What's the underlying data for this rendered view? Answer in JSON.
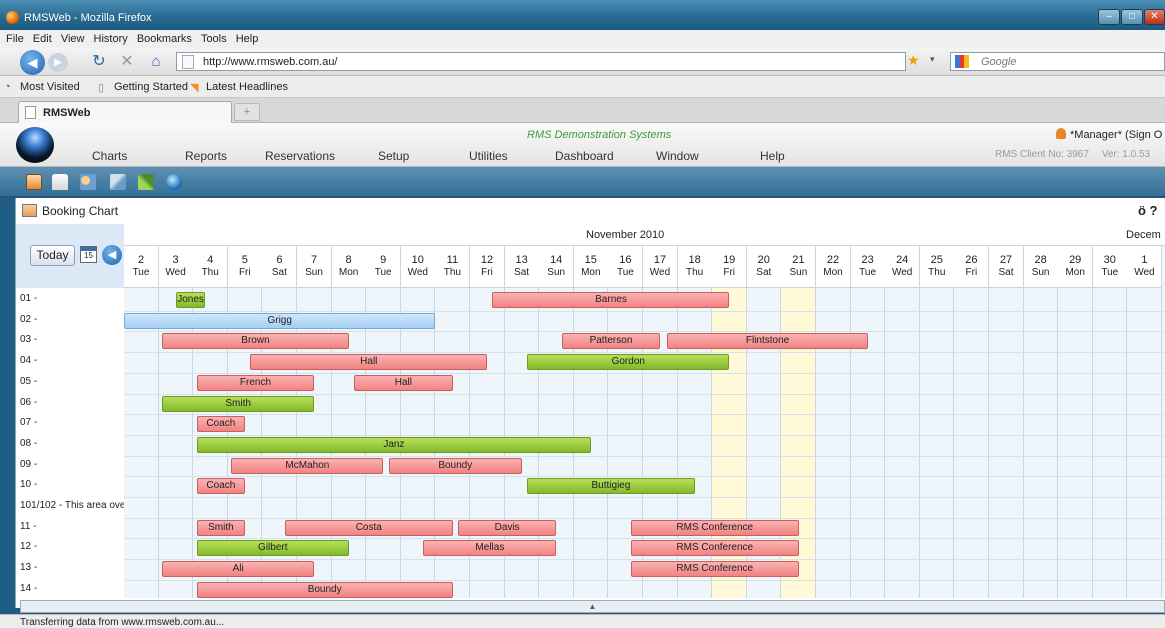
{
  "window": {
    "title": "RMSWeb - Mozilla Firefox"
  },
  "menubar": [
    "File",
    "Edit",
    "View",
    "History",
    "Bookmarks",
    "Tools",
    "Help"
  ],
  "address": {
    "url": "http://www.rmsweb.com.au/",
    "search_placeholder": "Google"
  },
  "bookmarks": [
    "Most Visited",
    "Getting Started",
    "Latest Headlines"
  ],
  "tab": {
    "label": "RMSWeb",
    "new_tab": "+"
  },
  "app": {
    "company": "RMS Demonstration Systems",
    "menu": [
      "Charts",
      "Reports",
      "Reservations",
      "Setup",
      "Utilities",
      "Dashboard",
      "Window",
      "Help"
    ],
    "user": "*Manager* (Sign O",
    "client": "RMS Client No: 3967",
    "version": "Ver: 1.0.53"
  },
  "toolbar_icons": [
    "calendar-icon",
    "truck-icon",
    "people-icon",
    "tools-icon",
    "satellite-icon",
    "globe-refresh-icon"
  ],
  "panel": {
    "title": "Booking Chart",
    "tools": "ö ?"
  },
  "nav": {
    "today_label": "Today",
    "cal_day": "15",
    "prev_glyph": "◀"
  },
  "chart": {
    "month": "November 2010",
    "next_month": "Decem",
    "days": [
      {
        "n": "2",
        "d": "Tue"
      },
      {
        "n": "3",
        "d": "Wed"
      },
      {
        "n": "4",
        "d": "Thu"
      },
      {
        "n": "5",
        "d": "Fri"
      },
      {
        "n": "6",
        "d": "Sat"
      },
      {
        "n": "7",
        "d": "Sun"
      },
      {
        "n": "8",
        "d": "Mon"
      },
      {
        "n": "9",
        "d": "Tue"
      },
      {
        "n": "10",
        "d": "Wed"
      },
      {
        "n": "11",
        "d": "Thu"
      },
      {
        "n": "12",
        "d": "Fri"
      },
      {
        "n": "13",
        "d": "Sat"
      },
      {
        "n": "14",
        "d": "Sun"
      },
      {
        "n": "15",
        "d": "Mon"
      },
      {
        "n": "16",
        "d": "Tue"
      },
      {
        "n": "17",
        "d": "Wed"
      },
      {
        "n": "18",
        "d": "Thu"
      },
      {
        "n": "19",
        "d": "Fri"
      },
      {
        "n": "20",
        "d": "Sat"
      },
      {
        "n": "21",
        "d": "Sun"
      },
      {
        "n": "22",
        "d": "Mon"
      },
      {
        "n": "23",
        "d": "Tue"
      },
      {
        "n": "24",
        "d": "Wed"
      },
      {
        "n": "25",
        "d": "Thu"
      },
      {
        "n": "26",
        "d": "Fri"
      },
      {
        "n": "27",
        "d": "Sat"
      },
      {
        "n": "28",
        "d": "Sun"
      },
      {
        "n": "29",
        "d": "Mon"
      },
      {
        "n": "30",
        "d": "Tue"
      },
      {
        "n": "1",
        "d": "Wed"
      }
    ],
    "highlight_days": [
      "19",
      "21"
    ],
    "rows": [
      "01 -",
      "02 -",
      "03 -",
      "04 -",
      "05 -",
      "06 -",
      "07 -",
      "08 -",
      "09 -",
      "10 -",
      "101/102 - This area ove",
      "11 -",
      "12 -",
      "13 -",
      "14 -"
    ],
    "colors": {
      "pink": "#f28282",
      "green": "#84b92a",
      "blue": "#a3cff2",
      "highlight": "#fff9d8"
    },
    "bookings": [
      {
        "row": 0,
        "start": 3.0,
        "end": 3.85,
        "label": "Jones",
        "color": "green"
      },
      {
        "row": 0,
        "start": 12.15,
        "end": 19.0,
        "label": "Barnes",
        "color": "pink"
      },
      {
        "row": 1,
        "start": 1.5,
        "end": 10.5,
        "label": "Grigg",
        "color": "blue"
      },
      {
        "row": 2,
        "start": 2.6,
        "end": 8.0,
        "label": "Brown",
        "color": "pink"
      },
      {
        "row": 2,
        "start": 14.15,
        "end": 17.0,
        "label": "Patterson",
        "color": "pink"
      },
      {
        "row": 2,
        "start": 17.2,
        "end": 23.0,
        "label": "Flintstone",
        "color": "pink"
      },
      {
        "row": 3,
        "start": 5.15,
        "end": 12.0,
        "label": "Hall",
        "color": "pink"
      },
      {
        "row": 3,
        "start": 13.15,
        "end": 19.0,
        "label": "Gordon",
        "color": "green"
      },
      {
        "row": 4,
        "start": 3.6,
        "end": 7.0,
        "label": "French",
        "color": "pink"
      },
      {
        "row": 4,
        "start": 8.15,
        "end": 11.0,
        "label": "Hall",
        "color": "pink"
      },
      {
        "row": 5,
        "start": 2.6,
        "end": 7.0,
        "label": "Smith",
        "color": "green"
      },
      {
        "row": 6,
        "start": 3.6,
        "end": 5.0,
        "label": "Coach",
        "color": "pink"
      },
      {
        "row": 7,
        "start": 3.6,
        "end": 15.0,
        "label": "Janz",
        "color": "green"
      },
      {
        "row": 8,
        "start": 4.6,
        "end": 9.0,
        "label": "McMahon",
        "color": "pink"
      },
      {
        "row": 8,
        "start": 9.15,
        "end": 13.0,
        "label": "Boundy",
        "color": "pink"
      },
      {
        "row": 9,
        "start": 3.6,
        "end": 5.0,
        "label": "Coach",
        "color": "pink"
      },
      {
        "row": 9,
        "start": 13.15,
        "end": 18.0,
        "label": "Buttigieg",
        "color": "green"
      },
      {
        "row": 11,
        "start": 3.6,
        "end": 5.0,
        "label": "Smith",
        "color": "pink"
      },
      {
        "row": 11,
        "start": 6.15,
        "end": 11.0,
        "label": "Costa",
        "color": "pink"
      },
      {
        "row": 11,
        "start": 11.15,
        "end": 14.0,
        "label": "Davis",
        "color": "pink"
      },
      {
        "row": 11,
        "start": 16.15,
        "end": 21.0,
        "label": "RMS Conference",
        "color": "pink"
      },
      {
        "row": 12,
        "start": 3.6,
        "end": 8.0,
        "label": "Gilbert",
        "color": "green"
      },
      {
        "row": 12,
        "start": 10.15,
        "end": 14.0,
        "label": "Mellas",
        "color": "pink"
      },
      {
        "row": 12,
        "start": 16.15,
        "end": 21.0,
        "label": "RMS Conference",
        "color": "pink"
      },
      {
        "row": 13,
        "start": 2.6,
        "end": 7.0,
        "label": "Ali",
        "color": "pink"
      },
      {
        "row": 13,
        "start": 16.15,
        "end": 21.0,
        "label": "RMS Conference",
        "color": "pink"
      },
      {
        "row": 14,
        "start": 3.6,
        "end": 11.0,
        "label": "Boundy",
        "color": "pink"
      }
    ]
  },
  "status": "Transferring data from www.rmsweb.com.au..."
}
